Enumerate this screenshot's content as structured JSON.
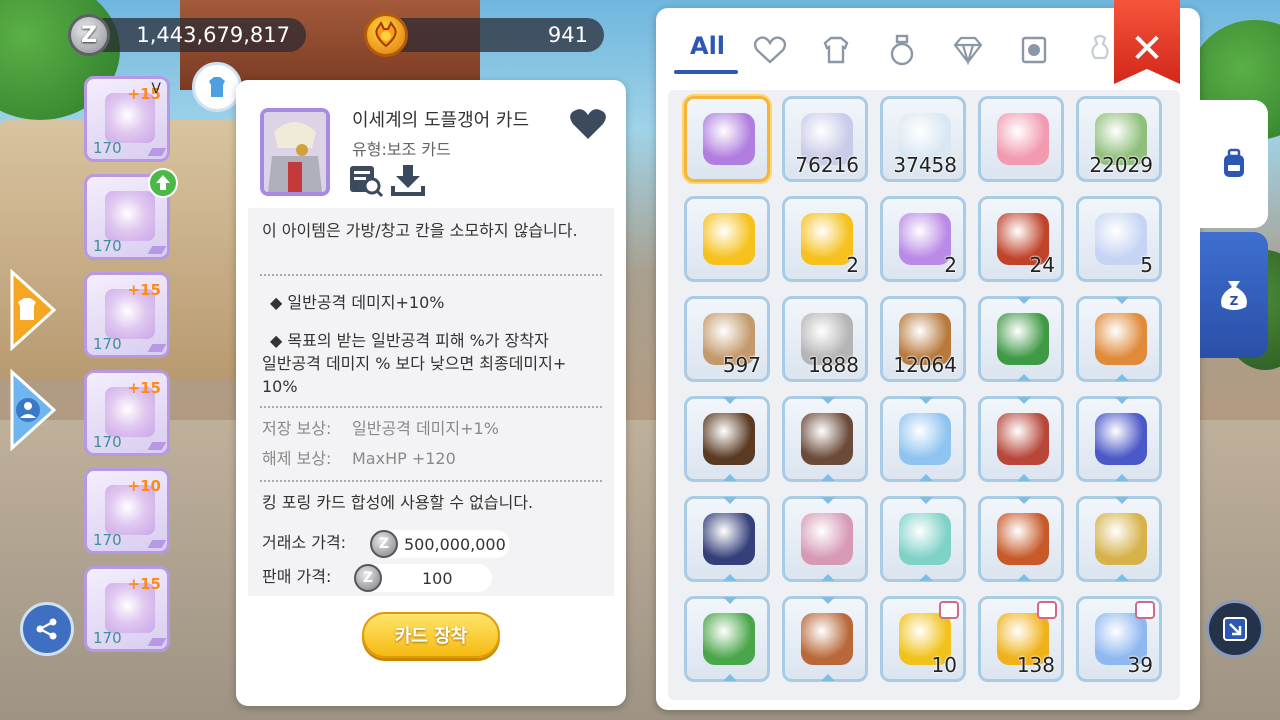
{
  "currency": {
    "zeny": "1,443,679,817",
    "cat_coin": "941",
    "zeny_icon_letter": "Z"
  },
  "equipment_slots": [
    {
      "level": "170",
      "plus": "+15",
      "mark": "V",
      "icon": "crossbow-icon"
    },
    {
      "level": "170",
      "plus": "",
      "mark": "",
      "icon": "robe-armor-icon"
    },
    {
      "level": "170",
      "plus": "+15",
      "mark": "",
      "icon": "red-cape-icon"
    },
    {
      "level": "170",
      "plus": "+15",
      "mark": "",
      "icon": "boots-icon"
    },
    {
      "level": "170",
      "plus": "+10",
      "mark": "",
      "icon": "potion-bottle-icon"
    },
    {
      "level": "170",
      "plus": "+15",
      "mark": "",
      "icon": "green-gem-icon"
    }
  ],
  "detail": {
    "name": "이세계의 도플갱어 카드",
    "type": "유형:보조 카드",
    "desc1": "이 아이템은 가방/창고 칸을 소모하지 않습니다.",
    "effect1": "◆ 일반공격 데미지+10%",
    "effect2_l1": "◆ 목표의 받는 일반공격 피해 %가 장착자",
    "effect2_l2": "일반공격 데미지 % 보다 낮으면 최종데미지+",
    "effect2_l3": "10%",
    "storage_label": "저장 보상:",
    "storage_value": "일반공격 데미지+1%",
    "unlock_label": "해제 보상:",
    "unlock_value": "MaxHP +120",
    "synth_note": "킹 포링 카드 합성에 사용할 수 없습니다.",
    "exchange_label": "거래소 가격:",
    "exchange_price": "500,000,000",
    "sell_label": "판매 가격:",
    "sell_price": "100",
    "equip_button": "카드 장착"
  },
  "inventory": {
    "tab_all": "All",
    "tabs": [
      "heart-icon",
      "armor-icon",
      "potion-icon",
      "gem-icon",
      "card-icon",
      "misc-icon"
    ],
    "items": [
      {
        "icon": "doppelganger-card-icon",
        "count": "",
        "color": "#b07de0",
        "selected": true
      },
      {
        "icon": "butterfly-wing-icon",
        "count": "76216",
        "color": "#c9cbe8"
      },
      {
        "icon": "fly-wing-icon",
        "count": "37458",
        "color": "#d9e7f2"
      },
      {
        "icon": "ring-gem-icon",
        "count": "",
        "color": "#f29ab0"
      },
      {
        "icon": "leaf-icon",
        "count": "22029",
        "color": "#8fbf7a"
      },
      {
        "icon": "star-coin-icon",
        "count": "",
        "color": "#f6c11c"
      },
      {
        "icon": "mystery-coin-icon",
        "count": "2",
        "color": "#f6c11c"
      },
      {
        "icon": "orb-basket-icon",
        "count": "2",
        "color": "#b98ae6"
      },
      {
        "icon": "staff-dagger-icon",
        "count": "24",
        "color": "#c0442c"
      },
      {
        "icon": "holo-cube-icon",
        "count": "5",
        "color": "#c6d4f4"
      },
      {
        "icon": "brown-chest-icon",
        "count": "597",
        "color": "#c49a6c"
      },
      {
        "icon": "silver-chest-icon",
        "count": "1888",
        "color": "#b5b5b5"
      },
      {
        "icon": "coin-sack-icon",
        "count": "12064",
        "color": "#b87a3c"
      },
      {
        "icon": "green-book-icon",
        "count": "",
        "color": "#3f9a46",
        "arrows": true
      },
      {
        "icon": "orange-bag-icon",
        "count": "",
        "color": "#e08a3a",
        "arrows": true
      },
      {
        "icon": "dark-tome-icon",
        "count": "",
        "color": "#5a3a22",
        "arrows": true
      },
      {
        "icon": "paw-pouch-icon",
        "count": "",
        "color": "#6b4a3a",
        "arrows": true
      },
      {
        "icon": "crystal-chest-icon",
        "count": "",
        "color": "#8fc4f0",
        "arrows": true
      },
      {
        "icon": "red-book-icon",
        "count": "",
        "color": "#b8473a",
        "arrows": true
      },
      {
        "icon": "blue-pillow-icon",
        "count": "",
        "color": "#4a58c8",
        "arrows": true
      },
      {
        "icon": "magic-drum-icon",
        "count": "",
        "color": "#35407a",
        "arrows": true
      },
      {
        "icon": "backpack-icon",
        "count": "",
        "color": "#d79ab6",
        "arrows": true
      },
      {
        "icon": "egg-box-icon",
        "count": "",
        "color": "#7fd2c8",
        "arrows": true
      },
      {
        "icon": "orange-book-icon",
        "count": "",
        "color": "#c85a2a",
        "arrows": true
      },
      {
        "icon": "golden-statue-icon",
        "count": "",
        "color": "#d6b24a",
        "arrows": true
      },
      {
        "icon": "mystery-box-icon",
        "count": "",
        "color": "#4aa64a",
        "arrows": true
      },
      {
        "icon": "leather-bag-icon",
        "count": "",
        "color": "#b9683a",
        "arrows": true
      },
      {
        "icon": "ticket-icon",
        "count": "10",
        "color": "#f1c21b",
        "badge": "shop"
      },
      {
        "icon": "golden-apple-icon",
        "count": "138",
        "color": "#f0b21c",
        "badge": "clock"
      },
      {
        "icon": "moon-icon",
        "count": "39",
        "color": "#8fb8f0",
        "badge": "shop"
      }
    ]
  },
  "side_tabs": [
    "backpack-icon",
    "zeny-bag-icon"
  ]
}
